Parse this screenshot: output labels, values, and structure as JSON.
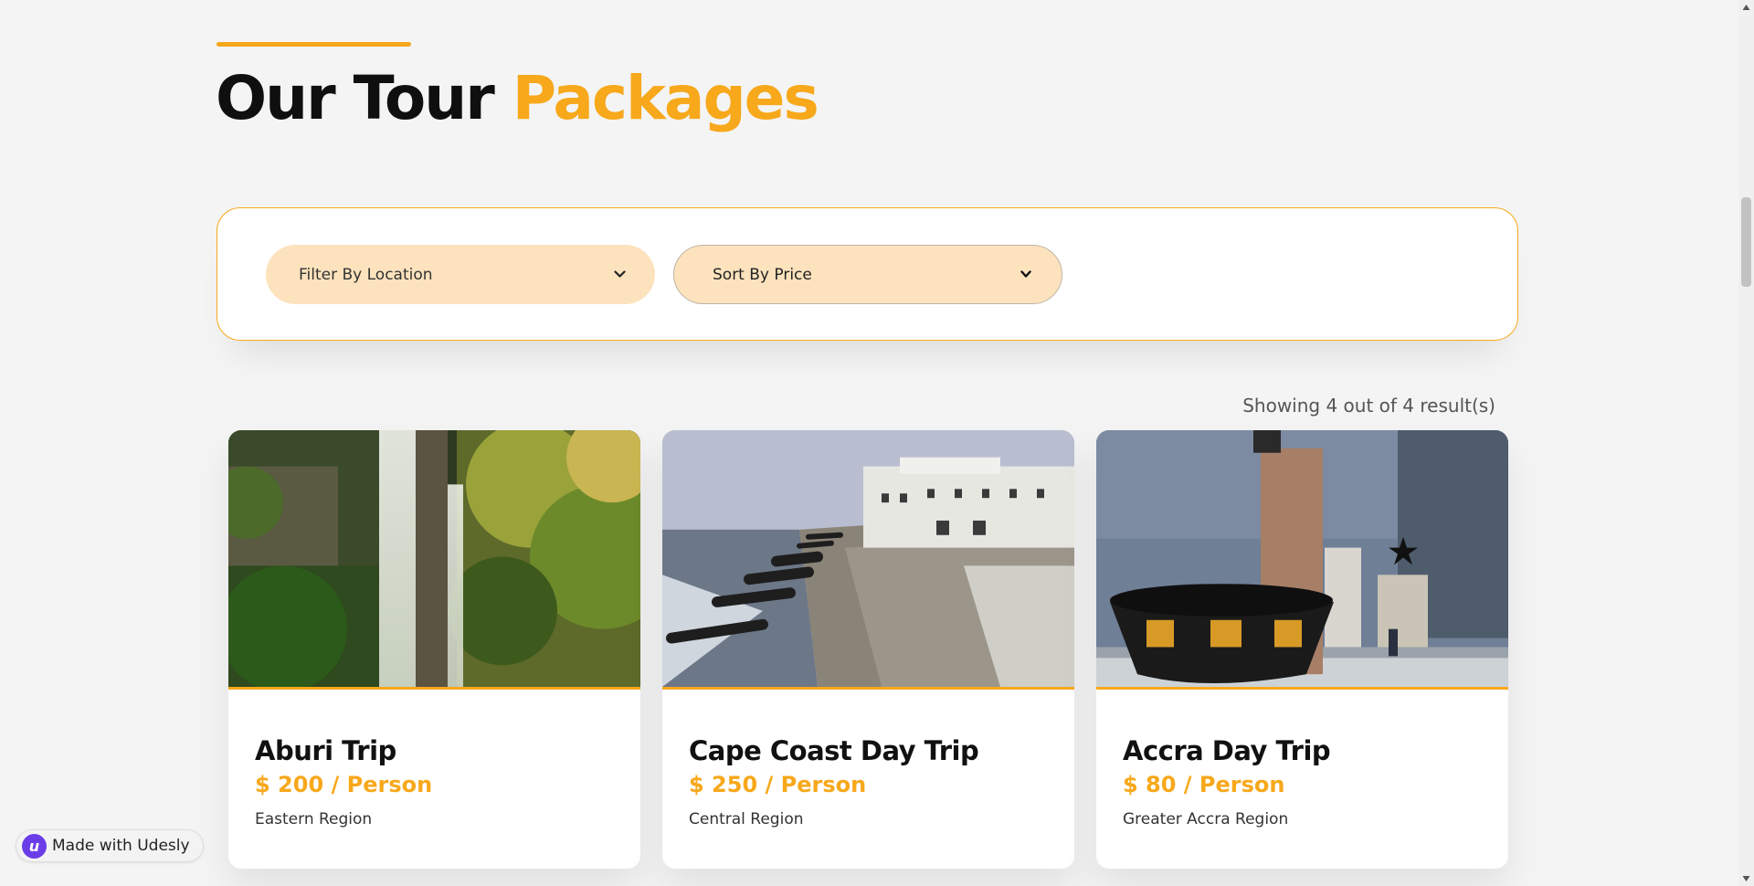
{
  "header": {
    "title_part1": "Our Tour",
    "title_part2": "Packages"
  },
  "filters": {
    "location_select": "Filter By Location",
    "price_select": "Sort By Price"
  },
  "results": {
    "summary": "Showing 4 out of 4 result(s)"
  },
  "tours": [
    {
      "name": "Aburi Trip",
      "price": "$ 200 / Person",
      "region": "Eastern Region",
      "image": "waterfall-forest"
    },
    {
      "name": "Cape Coast Day Trip",
      "price": "$ 250 / Person",
      "region": "Central Region",
      "image": "castle-cannons"
    },
    {
      "name": "Accra Day Trip",
      "price": "$ 80 / Person",
      "region": "Greater Accra Region",
      "image": "independence-monument"
    }
  ],
  "badge": {
    "logo_letter": "u",
    "label": "Made with Udesly"
  },
  "colors": {
    "accent": "#f7a81b",
    "select_bg": "#fce3bd",
    "page_bg": "#f4f4f4"
  },
  "icons": [
    "chevron-down-icon",
    "udesly-logo-icon",
    "scroll-up-icon",
    "scroll-down-icon"
  ]
}
